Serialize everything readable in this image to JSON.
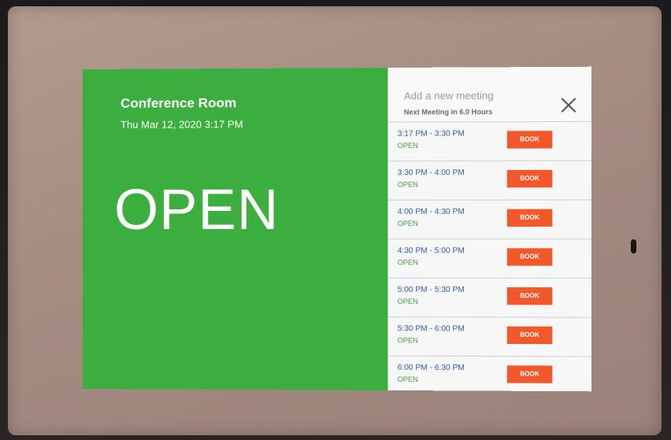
{
  "room": {
    "name": "Conference Room",
    "datetime": "Thu Mar 12, 2020 3:17 PM",
    "status": "OPEN",
    "status_color": "#3cae3f"
  },
  "side_panel": {
    "add_meeting_placeholder": "Add a new meeting",
    "next_meeting": "Next Meeting in 6.0 Hours",
    "close_icon": "close-icon"
  },
  "slots": [
    {
      "time": "3:17 PM - 3:30 PM",
      "status": "OPEN",
      "button": "BOOK"
    },
    {
      "time": "3:30 PM - 4:00 PM",
      "status": "OPEN",
      "button": "BOOK"
    },
    {
      "time": "4:00 PM - 4:30 PM",
      "status": "OPEN",
      "button": "BOOK"
    },
    {
      "time": "4:30 PM - 5:00 PM",
      "status": "OPEN",
      "button": "BOOK"
    },
    {
      "time": "5:00 PM - 5:30 PM",
      "status": "OPEN",
      "button": "BOOK"
    },
    {
      "time": "5:30 PM - 6:00 PM",
      "status": "OPEN",
      "button": "BOOK"
    },
    {
      "time": "6:00 PM - 6:30 PM",
      "status": "OPEN",
      "button": "BOOK"
    }
  ],
  "colors": {
    "book_button": "#f2582a",
    "slot_time": "#3358a8",
    "slot_status": "#4a9a42"
  }
}
